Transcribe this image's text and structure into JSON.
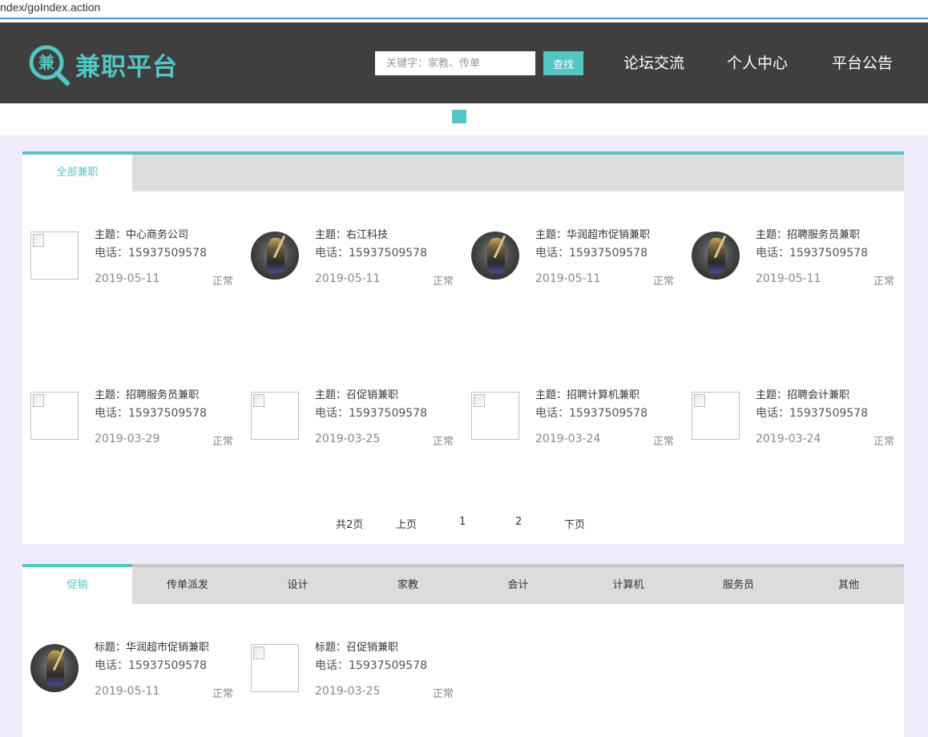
{
  "browser": {
    "url_fragment": "ndex/goIndex.action"
  },
  "header": {
    "logo_char": "兼",
    "brand": "兼职平台",
    "search_placeholder": "关键字：家教、传单",
    "search_button": "查找",
    "nav": [
      "论坛交流",
      "个人中心",
      "平台公告"
    ]
  },
  "colors": {
    "accent": "#52c6c3",
    "header_bg": "#3f3f3f",
    "band_bg": "#efecfc"
  },
  "panel1": {
    "tab": "全部兼职",
    "cards": [
      {
        "title": "主题：中心商务公司",
        "phone": "电话：15937509578",
        "date": "2019-05-11",
        "status": "正常",
        "image": "broken"
      },
      {
        "title": "主题：右江科技",
        "phone": "电话：15937509578",
        "date": "2019-05-11",
        "status": "正常",
        "image": "avatar"
      },
      {
        "title": "主题：华润超市促销兼职",
        "phone": "电话：15937509578",
        "date": "2019-05-11",
        "status": "正常",
        "image": "avatar"
      },
      {
        "title": "主题：招聘服务员兼职",
        "phone": "电话：15937509578",
        "date": "2019-05-11",
        "status": "正常",
        "image": "avatar"
      },
      {
        "title": "主题：招聘服务员兼职",
        "phone": "电话：15937509578",
        "date": "2019-03-29",
        "status": "正常",
        "image": "broken"
      },
      {
        "title": "主题：召促销兼职",
        "phone": "电话：15937509578",
        "date": "2019-03-25",
        "status": "正常",
        "image": "broken"
      },
      {
        "title": "主题：招聘计算机兼职",
        "phone": "电话：15937509578",
        "date": "2019-03-24",
        "status": "正常",
        "image": "broken"
      },
      {
        "title": "主题：招聘会计兼职",
        "phone": "电话：15937509578",
        "date": "2019-03-24",
        "status": "正常",
        "image": "broken"
      }
    ],
    "pager": {
      "total": "共2页",
      "prev": "上页",
      "page1": "1",
      "page2": "2",
      "next": "下页"
    }
  },
  "panel2": {
    "tabs": [
      "促销",
      "传单派发",
      "设计",
      "家教",
      "会计",
      "计算机",
      "服务员",
      "其他"
    ],
    "cards": [
      {
        "title": "标题：华润超市促销兼职",
        "phone": "电话：15937509578",
        "date": "2019-05-11",
        "status": "正常",
        "image": "avatar"
      },
      {
        "title": "标题：召促销兼职",
        "phone": "电话：15937509578",
        "date": "2019-03-25",
        "status": "正常",
        "image": "broken"
      }
    ]
  }
}
